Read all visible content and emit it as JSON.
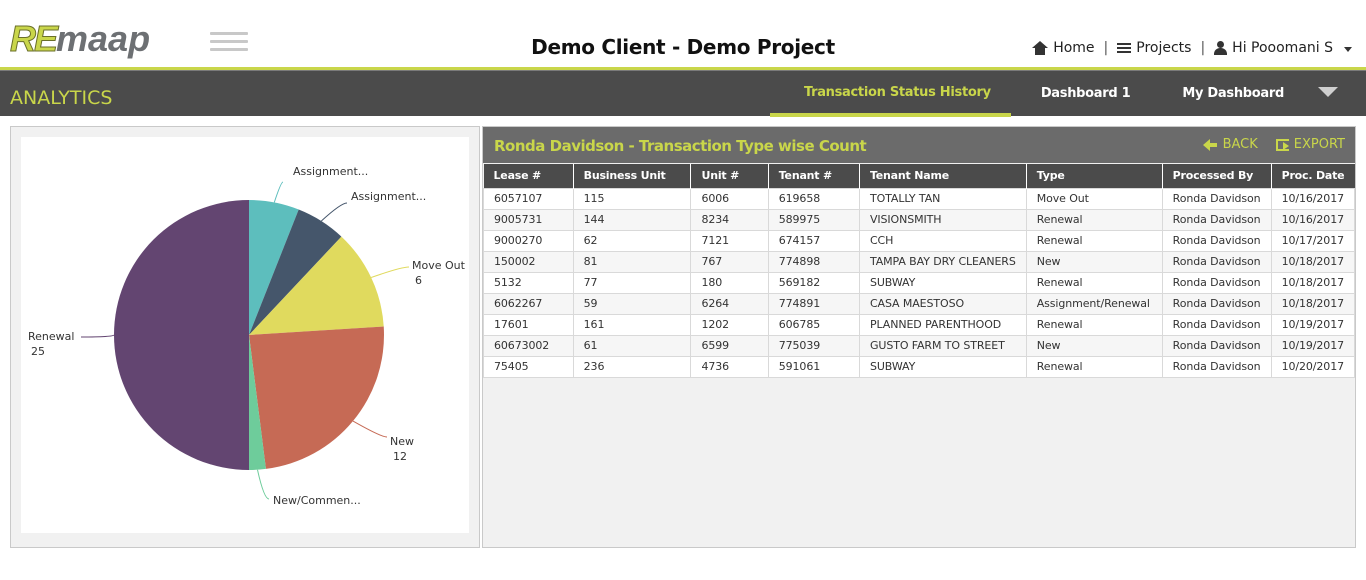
{
  "brand": {
    "logo_re": "RE",
    "logo_maap": "maap"
  },
  "header": {
    "title": "Demo Client - Demo Project",
    "nav": {
      "home": "Home",
      "projects": "Projects",
      "user": "Hi Pooomani S"
    }
  },
  "analytics": {
    "label": "ANALYTICS",
    "tabs": [
      {
        "label": "Transaction Status History",
        "active": true
      },
      {
        "label": "Dashboard 1",
        "active": false
      },
      {
        "label": "My Dashboard",
        "active": false
      }
    ]
  },
  "chart_data": {
    "type": "pie",
    "title": "",
    "slices": [
      {
        "label": "Assignment...",
        "value": 3,
        "color": "#5dbebd"
      },
      {
        "label": "Assignment...",
        "value": 3,
        "color": "#45566b"
      },
      {
        "label": "Move Out",
        "value": 6,
        "color": "#e0da5e"
      },
      {
        "label": "New",
        "value": 12,
        "color": "#c66a55"
      },
      {
        "label": "New/Commen...",
        "value": 1,
        "color": "#6ecc9b"
      },
      {
        "label": "Renewal",
        "value": 25,
        "color": "#634571"
      }
    ],
    "printed_labels": [
      {
        "name": "Assignment...",
        "value": ""
      },
      {
        "name": "Assignment...",
        "value": ""
      },
      {
        "name": "Move Out",
        "value": "6"
      },
      {
        "name": "New",
        "value": "12"
      },
      {
        "name": "New/Commen...",
        "value": ""
      },
      {
        "name": "Renewal",
        "value": "25"
      }
    ]
  },
  "panel": {
    "title": "Ronda Davidson - Transaction Type wise Count",
    "back": "BACK",
    "export": "EXPORT"
  },
  "table": {
    "columns": [
      "Lease #",
      "Business Unit",
      "Unit #",
      "Tenant #",
      "Tenant Name",
      "Type",
      "Processed By",
      "Proc. Date"
    ],
    "rows": [
      [
        "6057107",
        "115",
        "6006",
        "619658",
        "TOTALLY TAN",
        "Move Out",
        "Ronda Davidson",
        "10/16/2017"
      ],
      [
        "9005731",
        "144",
        "8234",
        "589975",
        "VISIONSMITH",
        "Renewal",
        "Ronda Davidson",
        "10/16/2017"
      ],
      [
        "9000270",
        "62",
        "7121",
        "674157",
        "CCH",
        "Renewal",
        "Ronda Davidson",
        "10/17/2017"
      ],
      [
        "150002",
        "81",
        "767",
        "774898",
        "TAMPA BAY DRY CLEANERS",
        "New",
        "Ronda Davidson",
        "10/18/2017"
      ],
      [
        "5132",
        "77",
        "180",
        "569182",
        "SUBWAY",
        "Renewal",
        "Ronda Davidson",
        "10/18/2017"
      ],
      [
        "6062267",
        "59",
        "6264",
        "774891",
        "CASA MAESTOSO",
        "Assignment/Renewal",
        "Ronda Davidson",
        "10/18/2017"
      ],
      [
        "17601",
        "161",
        "1202",
        "606785",
        "PLANNED PARENTHOOD",
        "Renewal",
        "Ronda Davidson",
        "10/19/2017"
      ],
      [
        "60673002",
        "61",
        "6599",
        "775039",
        "GUSTO FARM TO STREET",
        "New",
        "Ronda Davidson",
        "10/19/2017"
      ],
      [
        "75405",
        "236",
        "4736",
        "591061",
        "SUBWAY",
        "Renewal",
        "Ronda Davidson",
        "10/20/2017"
      ]
    ]
  }
}
